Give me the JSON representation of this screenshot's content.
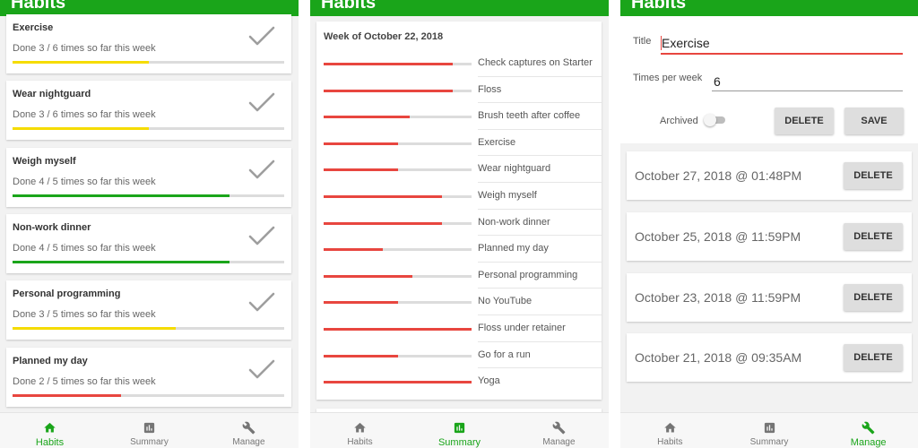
{
  "app_title": "Habits",
  "nav": {
    "habits": "Habits",
    "summary": "Summary",
    "manage": "Manage"
  },
  "colors": {
    "brand": "#1aa51a",
    "yellow": "#f5dc00",
    "green": "#1aa51a",
    "red": "#e8463f"
  },
  "habits": [
    {
      "title": "Exercise",
      "status": "Done 3 / 6 times so far this week",
      "progress": 0.5,
      "color": "#f5dc00"
    },
    {
      "title": "Wear nightguard",
      "status": "Done 3 / 6 times so far this week",
      "progress": 0.5,
      "color": "#f5dc00"
    },
    {
      "title": "Weigh myself",
      "status": "Done 4 / 5 times so far this week",
      "progress": 0.8,
      "color": "#1aa51a"
    },
    {
      "title": "Non-work dinner",
      "status": "Done 4 / 5 times so far this week",
      "progress": 0.8,
      "color": "#1aa51a"
    },
    {
      "title": "Personal programming",
      "status": "Done 3 / 5 times so far this week",
      "progress": 0.6,
      "color": "#f5dc00"
    },
    {
      "title": "Planned my day",
      "status": "Done 2 / 5 times so far this week",
      "progress": 0.4,
      "color": "#e8463f"
    }
  ],
  "summary": {
    "week_label": "Week of October 22, 2018",
    "rows": [
      {
        "label": "Check captures on Starter",
        "progress": 0.87
      },
      {
        "label": "Floss",
        "progress": 0.87
      },
      {
        "label": "Brush teeth after coffee",
        "progress": 0.58
      },
      {
        "label": "Exercise",
        "progress": 0.5
      },
      {
        "label": "Wear nightguard",
        "progress": 0.5
      },
      {
        "label": "Weigh myself",
        "progress": 0.8
      },
      {
        "label": "Non-work dinner",
        "progress": 0.8
      },
      {
        "label": "Planned my day",
        "progress": 0.4
      },
      {
        "label": "Personal programming",
        "progress": 0.6
      },
      {
        "label": "No YouTube",
        "progress": 0.5
      },
      {
        "label": "Floss under retainer",
        "progress": 1.0
      },
      {
        "label": "Go for a run",
        "progress": 0.5
      },
      {
        "label": "Yoga",
        "progress": 1.0
      }
    ]
  },
  "manage": {
    "title_label": "Title",
    "title_value": "Exercise",
    "times_label": "Times per week",
    "times_value": "6",
    "archived_label": "Archived",
    "archived": false,
    "delete_label": "DELETE",
    "save_label": "SAVE",
    "entries": [
      {
        "text": "October 27, 2018  @ 01:48PM",
        "button": "DELETE"
      },
      {
        "text": "October 25, 2018  @ 11:59PM",
        "button": "DELETE"
      },
      {
        "text": "October 23, 2018  @ 11:59PM",
        "button": "DELETE"
      },
      {
        "text": "October 21, 2018  @ 09:35AM",
        "button": "DELETE"
      }
    ]
  }
}
